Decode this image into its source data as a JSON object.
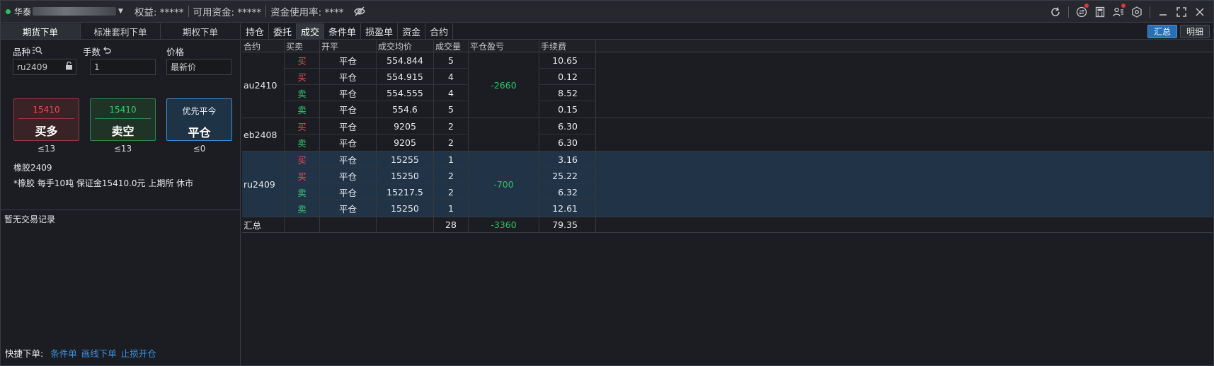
{
  "title": {
    "account_prefix": "华泰",
    "equity": "权益: *****",
    "available": "可用资金: *****",
    "usage": "资金使用率: ****"
  },
  "left_tabs": [
    "期货下单",
    "标准套利下单",
    "期权下单"
  ],
  "order": {
    "symbol_label": "品种",
    "qty_label": "手数",
    "price_label": "价格",
    "symbol_value": "ru2409",
    "qty_value": "1",
    "price_value": "最新价",
    "buy_price": "15410",
    "buy_label": "买多",
    "sell_price": "15410",
    "sell_label": "卖空",
    "close_top": "优先平今",
    "close_label": "平仓",
    "buy_limit": "≤13",
    "sell_limit": "≤13",
    "close_limit": "≤0",
    "contract_name": "橡胶2409",
    "contract_info": "*橡胶 每手10吨 保证金15410.0元 上期所 休市",
    "no_record": "暂无交易记录"
  },
  "quick": {
    "label": "快捷下单:",
    "links": [
      "条件单",
      "画线下单",
      "止损开仓"
    ]
  },
  "right_tabs": [
    "持仓",
    "委托",
    "成交",
    "条件单",
    "损盈单",
    "资金",
    "合约"
  ],
  "view_buttons": [
    "汇总",
    "明细"
  ],
  "columns": [
    "合约",
    "买卖",
    "开平",
    "成交均价",
    "成交量",
    "平仓盈亏",
    "手续费"
  ],
  "groups": [
    {
      "contract": "au2410",
      "pnl": "-2660",
      "rows": [
        {
          "side": "买",
          "oc": "平仓",
          "price": "554.844",
          "qty": "5",
          "fee": "10.65"
        },
        {
          "side": "买",
          "oc": "平仓",
          "price": "554.915",
          "qty": "4",
          "fee": "0.12"
        },
        {
          "side": "卖",
          "oc": "平仓",
          "price": "554.555",
          "qty": "4",
          "fee": "8.52"
        },
        {
          "side": "卖",
          "oc": "平仓",
          "price": "554.6",
          "qty": "5",
          "fee": "0.15"
        }
      ]
    },
    {
      "contract": "eb2408",
      "pnl": "",
      "rows": [
        {
          "side": "买",
          "oc": "平仓",
          "price": "9205",
          "qty": "2",
          "fee": "6.30"
        },
        {
          "side": "卖",
          "oc": "平仓",
          "price": "9205",
          "qty": "2",
          "fee": "6.30"
        }
      ]
    },
    {
      "contract": "ru2409",
      "pnl": "-700",
      "rows": [
        {
          "side": "买",
          "oc": "平仓",
          "price": "15255",
          "qty": "1",
          "fee": "3.16"
        },
        {
          "side": "买",
          "oc": "平仓",
          "price": "15250",
          "qty": "2",
          "fee": "25.22"
        },
        {
          "side": "卖",
          "oc": "平仓",
          "price": "15217.5",
          "qty": "2",
          "fee": "6.32"
        },
        {
          "side": "卖",
          "oc": "平仓",
          "price": "15250",
          "qty": "1",
          "fee": "12.61"
        }
      ]
    }
  ],
  "summary": {
    "label": "汇总",
    "qty": "28",
    "pnl": "-3360",
    "fee": "79.35"
  },
  "colors": {
    "buy": "#ef4b52",
    "sell": "#2fc26a",
    "accent": "#2a6fb4"
  },
  "icons": [
    "refresh-icon",
    "exchange-icon",
    "calculator-icon",
    "user-list-icon",
    "settings-icon",
    "minimize-icon",
    "maximize-icon",
    "close-icon"
  ]
}
